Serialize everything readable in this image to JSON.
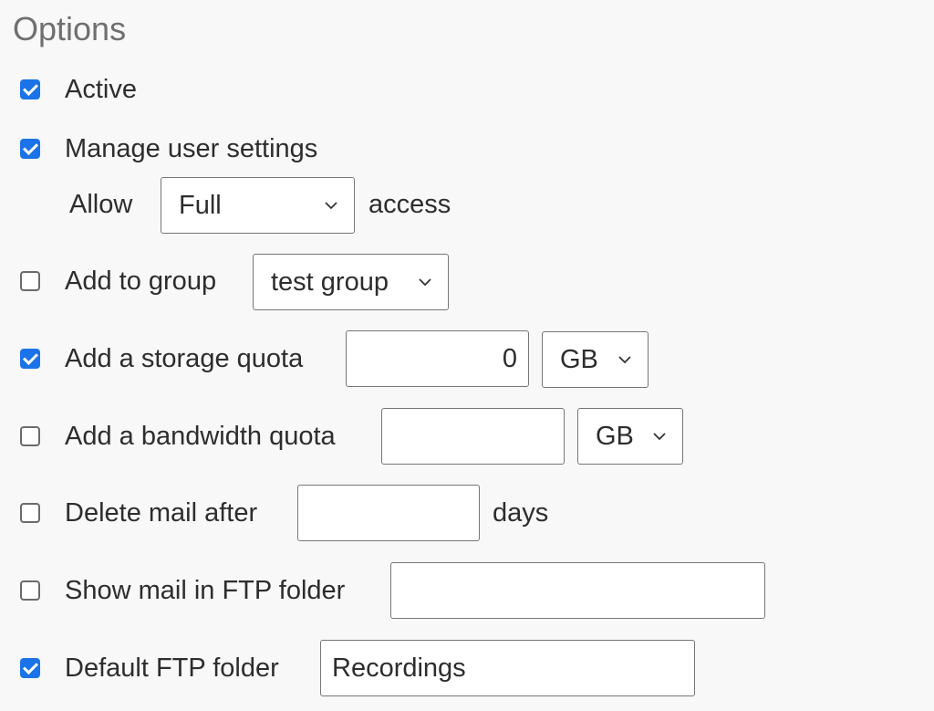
{
  "title": "Options",
  "options": {
    "active": {
      "label": "Active",
      "checked": true
    },
    "manage_user_settings": {
      "label": "Manage user settings",
      "checked": true,
      "allow_prefix": "Allow",
      "access_level": "Full",
      "access_suffix": "access"
    },
    "add_to_group": {
      "label": "Add to group",
      "checked": false,
      "group": "test group"
    },
    "storage_quota": {
      "label": "Add a storage quota",
      "checked": true,
      "value": "0",
      "unit": "GB"
    },
    "bandwidth_quota": {
      "label": "Add a bandwidth quota",
      "checked": false,
      "value": "",
      "unit": "GB"
    },
    "delete_mail": {
      "label": "Delete mail after",
      "checked": false,
      "value": "",
      "suffix": "days"
    },
    "ftp_mail_folder": {
      "label": "Show mail in FTP folder",
      "checked": false,
      "value": ""
    },
    "default_ftp_folder": {
      "label": "Default FTP folder",
      "checked": true,
      "value": "Recordings"
    }
  },
  "colors": {
    "accent": "#1a73e8",
    "background": "#f8f8f8",
    "title": "#6f6f6f",
    "text": "#2d2d2d"
  },
  "icons": {
    "checkbox_checked": "check-icon",
    "dropdown": "chevron-down-icon"
  }
}
